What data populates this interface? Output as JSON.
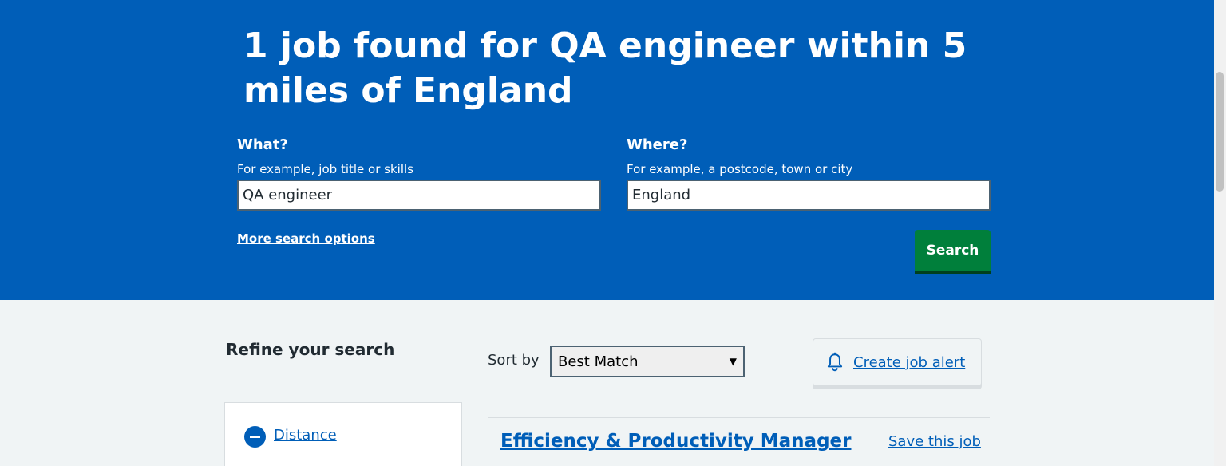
{
  "hero": {
    "title": "1 job found for QA engineer within 5 miles of England",
    "what": {
      "label": "What?",
      "hint": "For example, job title or skills",
      "value": "QA engineer"
    },
    "where": {
      "label": "Where?",
      "hint": "For example, a postcode, town or city",
      "value": "England"
    },
    "more_options": "More search options",
    "search_button": "Search"
  },
  "refine": {
    "title": "Refine your search",
    "filters": [
      {
        "label": "Distance",
        "icon": "minus-circle-icon",
        "expanded": true
      }
    ]
  },
  "results": {
    "sort_label": "Sort by",
    "sort_value": "Best Match",
    "create_alert": "Create job alert",
    "jobs": [
      {
        "title": "Efficiency & Productivity Manager",
        "save_label": "Save this job"
      }
    ]
  },
  "colors": {
    "brand_blue": "#005eb8",
    "button_green": "#007f3b",
    "background": "#f0f4f5"
  }
}
